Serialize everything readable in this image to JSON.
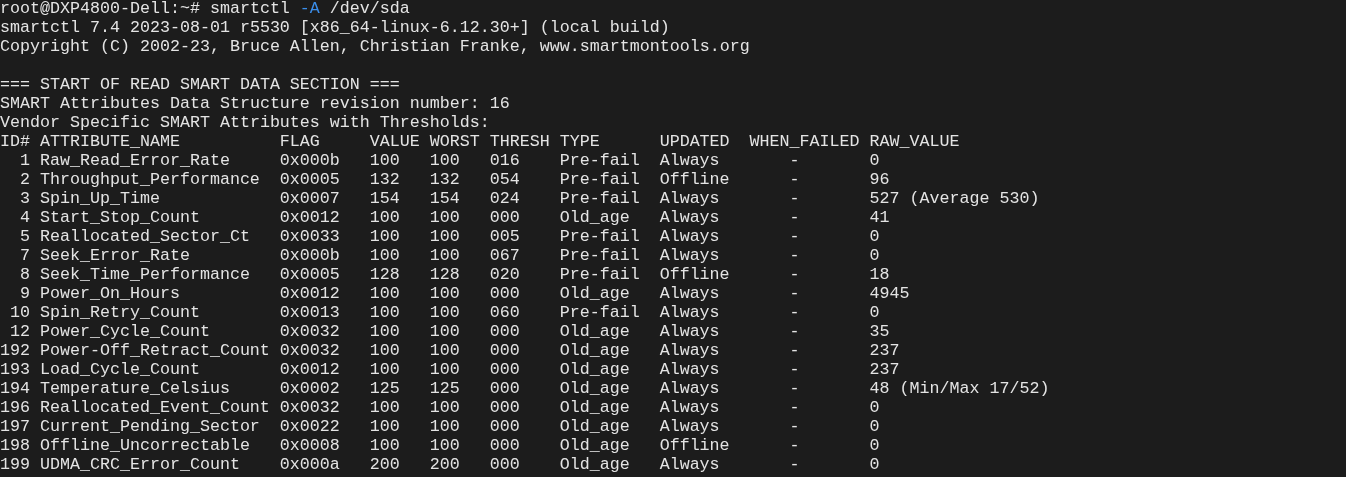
{
  "terminal": {
    "prompt": {
      "user_host": "root@DXP4800-Dell:~#",
      "command": "smartctl",
      "option": "-A",
      "argument": "/dev/sda"
    },
    "header_lines": [
      "smartctl 7.4 2023-08-01 r5530 [x86_64-linux-6.12.30+] (local build)",
      "Copyright (C) 2002-23, Bruce Allen, Christian Franke, www.smartmontools.org"
    ],
    "section_lines": [
      "=== START OF READ SMART DATA SECTION ===",
      "SMART Attributes Data Structure revision number: 16",
      "Vendor Specific SMART Attributes with Thresholds:"
    ],
    "table": {
      "columns": [
        "ID#",
        "ATTRIBUTE_NAME",
        "FLAG",
        "VALUE",
        "WORST",
        "THRESH",
        "TYPE",
        "UPDATED",
        "WHEN_FAILED",
        "RAW_VALUE"
      ],
      "rows": [
        [
          "1",
          "Raw_Read_Error_Rate",
          "0x000b",
          "100",
          "100",
          "016",
          "Pre-fail",
          "Always",
          "-",
          "0"
        ],
        [
          "2",
          "Throughput_Performance",
          "0x0005",
          "132",
          "132",
          "054",
          "Pre-fail",
          "Offline",
          "-",
          "96"
        ],
        [
          "3",
          "Spin_Up_Time",
          "0x0007",
          "154",
          "154",
          "024",
          "Pre-fail",
          "Always",
          "-",
          "527 (Average 530)"
        ],
        [
          "4",
          "Start_Stop_Count",
          "0x0012",
          "100",
          "100",
          "000",
          "Old_age",
          "Always",
          "-",
          "41"
        ],
        [
          "5",
          "Reallocated_Sector_Ct",
          "0x0033",
          "100",
          "100",
          "005",
          "Pre-fail",
          "Always",
          "-",
          "0"
        ],
        [
          "7",
          "Seek_Error_Rate",
          "0x000b",
          "100",
          "100",
          "067",
          "Pre-fail",
          "Always",
          "-",
          "0"
        ],
        [
          "8",
          "Seek_Time_Performance",
          "0x0005",
          "128",
          "128",
          "020",
          "Pre-fail",
          "Offline",
          "-",
          "18"
        ],
        [
          "9",
          "Power_On_Hours",
          "0x0012",
          "100",
          "100",
          "000",
          "Old_age",
          "Always",
          "-",
          "4945"
        ],
        [
          "10",
          "Spin_Retry_Count",
          "0x0013",
          "100",
          "100",
          "060",
          "Pre-fail",
          "Always",
          "-",
          "0"
        ],
        [
          "12",
          "Power_Cycle_Count",
          "0x0032",
          "100",
          "100",
          "000",
          "Old_age",
          "Always",
          "-",
          "35"
        ],
        [
          "192",
          "Power-Off_Retract_Count",
          "0x0032",
          "100",
          "100",
          "000",
          "Old_age",
          "Always",
          "-",
          "237"
        ],
        [
          "193",
          "Load_Cycle_Count",
          "0x0012",
          "100",
          "100",
          "000",
          "Old_age",
          "Always",
          "-",
          "237"
        ],
        [
          "194",
          "Temperature_Celsius",
          "0x0002",
          "125",
          "125",
          "000",
          "Old_age",
          "Always",
          "-",
          "48 (Min/Max 17/52)"
        ],
        [
          "196",
          "Reallocated_Event_Count",
          "0x0032",
          "100",
          "100",
          "000",
          "Old_age",
          "Always",
          "-",
          "0"
        ],
        [
          "197",
          "Current_Pending_Sector",
          "0x0022",
          "100",
          "100",
          "000",
          "Old_age",
          "Always",
          "-",
          "0"
        ],
        [
          "198",
          "Offline_Uncorrectable",
          "0x0008",
          "100",
          "100",
          "000",
          "Old_age",
          "Offline",
          "-",
          "0"
        ],
        [
          "199",
          "UDMA_CRC_Error_Count",
          "0x000a",
          "200",
          "200",
          "000",
          "Old_age",
          "Always",
          "-",
          "0"
        ]
      ]
    }
  }
}
